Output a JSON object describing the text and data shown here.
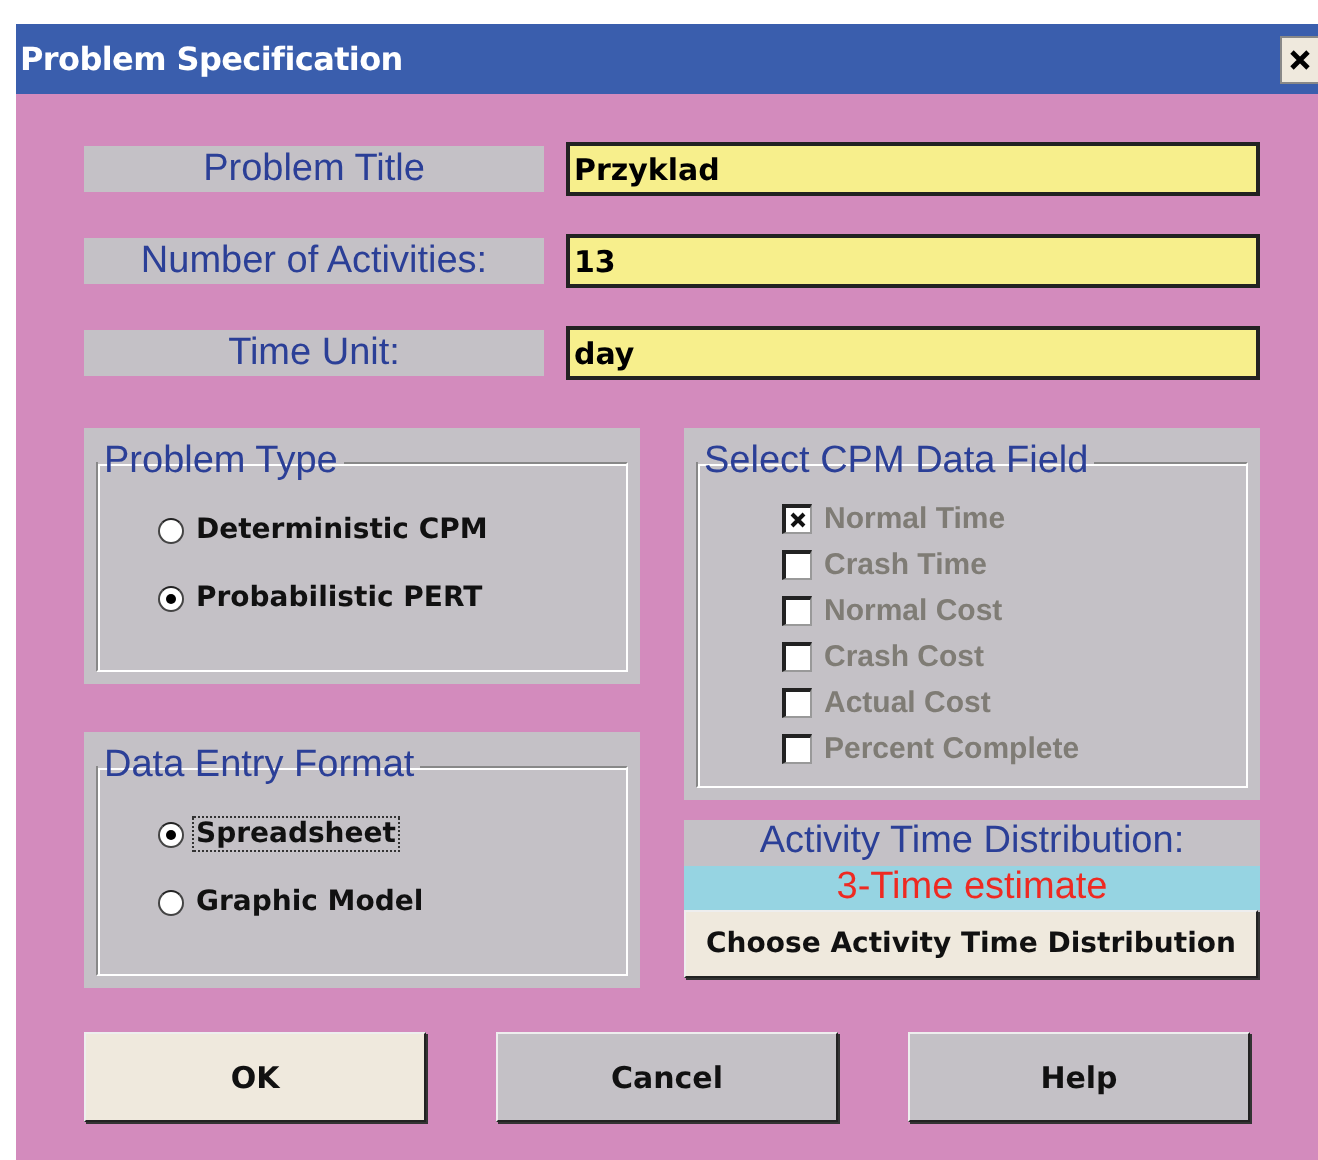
{
  "window": {
    "title": "Problem Specification"
  },
  "fields": [
    {
      "label": "Problem Title",
      "value": "Przyklad"
    },
    {
      "label": "Number of Activities:",
      "value": "13"
    },
    {
      "label": "Time Unit:",
      "value": "day"
    }
  ],
  "problem_type": {
    "title": "Problem Type",
    "options": [
      {
        "label": "Deterministic CPM",
        "selected": false,
        "focused": false
      },
      {
        "label": "Probabilistic PERT",
        "selected": true,
        "focused": false
      }
    ]
  },
  "data_entry_format": {
    "title": "Data Entry Format",
    "options": [
      {
        "label": "Spreadsheet",
        "selected": true,
        "focused": true
      },
      {
        "label": "Graphic Model",
        "selected": false,
        "focused": false
      }
    ]
  },
  "cpm_data_field": {
    "title": "Select CPM Data Field",
    "items": [
      {
        "label": "Normal Time",
        "checked": true,
        "disabled": true
      },
      {
        "label": "Crash Time",
        "checked": false,
        "disabled": true
      },
      {
        "label": "Normal Cost",
        "checked": false,
        "disabled": true
      },
      {
        "label": "Crash Cost",
        "checked": false,
        "disabled": true
      },
      {
        "label": "Actual Cost",
        "checked": false,
        "disabled": true
      },
      {
        "label": "Percent Complete",
        "checked": false,
        "disabled": true
      }
    ]
  },
  "activity_time_distribution": {
    "label": "Activity Time Distribution:",
    "value": "3-Time estimate",
    "button": {
      "label": "Choose Activity Time Distribution",
      "default": true
    }
  },
  "buttons": [
    {
      "label": "OK",
      "default": true
    },
    {
      "label": "Cancel",
      "default": false
    },
    {
      "label": "Help",
      "default": false
    }
  ]
}
